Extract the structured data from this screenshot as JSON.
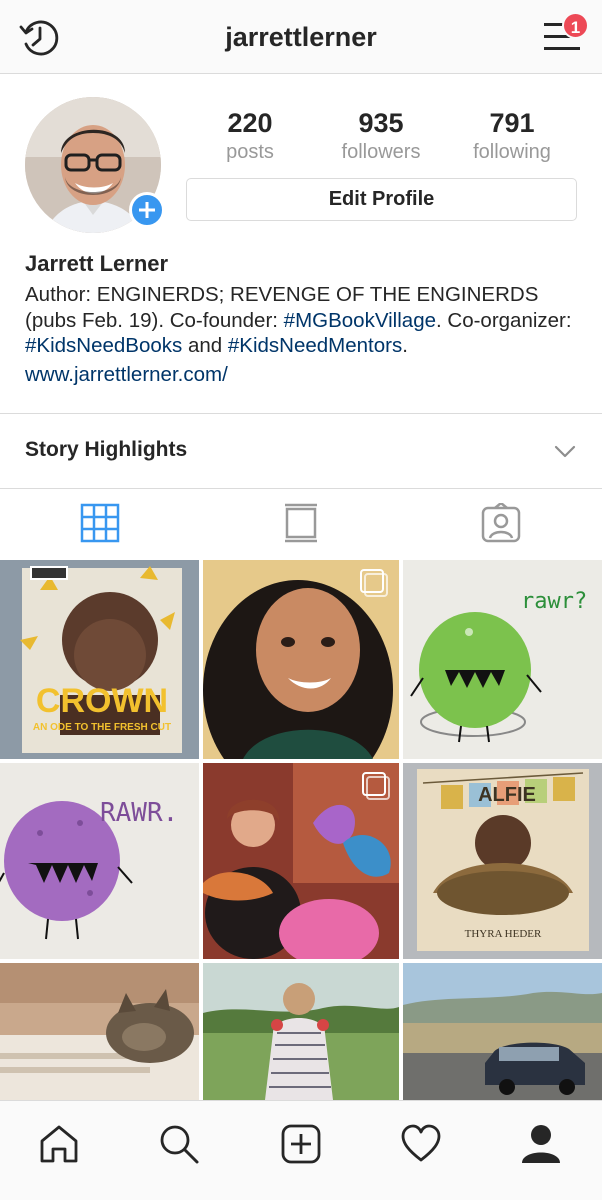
{
  "header": {
    "username": "jarrettlerner",
    "notification_count": "1",
    "history_icon": "history-clock-icon",
    "menu_icon": "hamburger-menu-icon"
  },
  "profile": {
    "stats": [
      {
        "num": "220",
        "label": "posts"
      },
      {
        "num": "935",
        "label": "followers"
      },
      {
        "num": "791",
        "label": "following"
      }
    ],
    "edit_label": "Edit Profile",
    "name": "Jarrett Lerner",
    "bio": {
      "p1": "Author: ENGINERDS; REVENGE OF THE ENGINERDS (pubs Feb. 19). Co-founder: ",
      "t1": "#MGBookVillage",
      "p2": ". Co-organizer: ",
      "t2": "#KidsNeedBooks",
      "p3": " and ",
      "t3": "#KidsNeedMentors",
      "p4": "."
    },
    "website": "www.jarrettlerner.com/"
  },
  "highlights": {
    "label": "Story Highlights"
  },
  "tabs": [
    "grid-icon",
    "list-icon",
    "tagged-icon"
  ],
  "colors": {
    "accent": "#3897f0",
    "badge": "#ed4956",
    "link": "#003569",
    "muted": "#999999"
  },
  "posts": [
    {
      "alt": "Crown: An Ode to the Fresh Cut book cover"
    },
    {
      "alt": "Smiling woman portrait"
    },
    {
      "alt": "Green monster drawing rawr"
    },
    {
      "alt": "Purple monster drawing RAWR"
    },
    {
      "alt": "Woman with colorful monster drawings"
    },
    {
      "alt": "Alfie book cover by Thyra Heder"
    },
    {
      "alt": "Cat sleeping on books"
    },
    {
      "alt": "Toddler in striped dress on grass"
    },
    {
      "alt": "Car on highway"
    }
  ],
  "post_text": {
    "crown_title": "CROWN",
    "crown_sub": "AN ODE TO THE FRESH CUT",
    "rawr_small": "rawr?",
    "rawr_big": "RAWR.",
    "alfie": "ALFIE",
    "thyra": "THYRA HEDER"
  },
  "bottom_nav": [
    "home-icon",
    "search-icon",
    "new-post-icon",
    "activity-heart-icon",
    "profile-icon"
  ]
}
